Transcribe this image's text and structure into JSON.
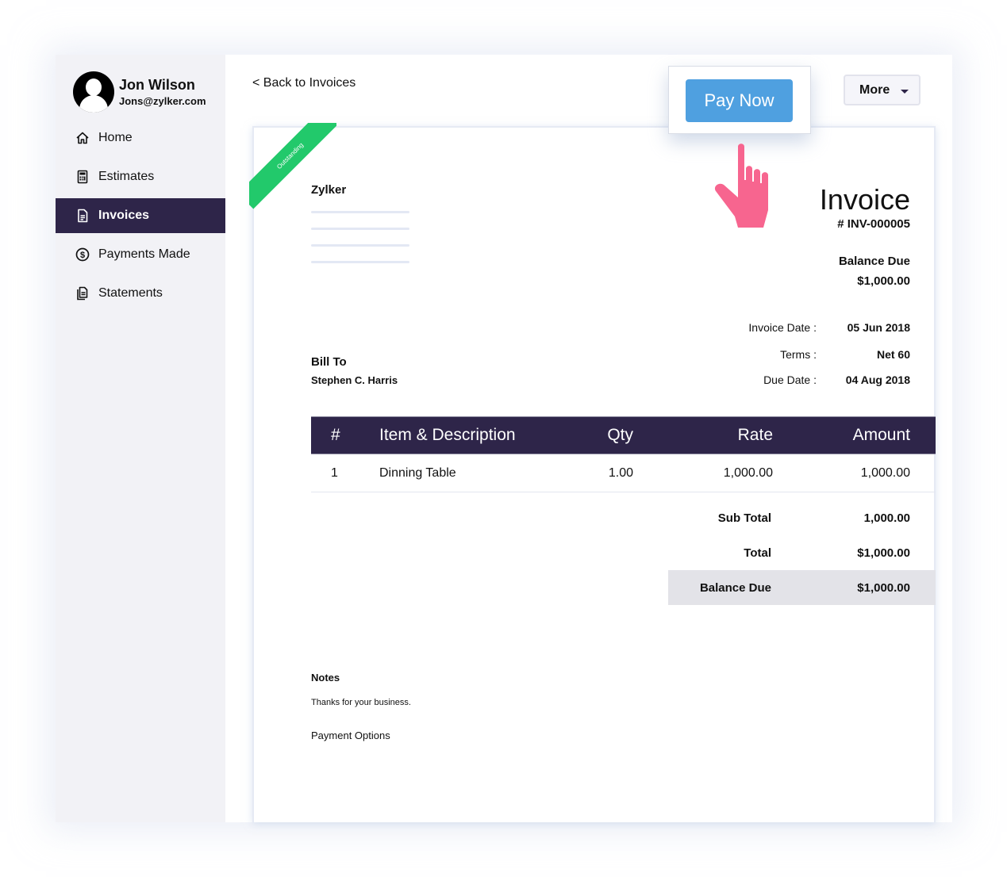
{
  "user": {
    "name": "Jon Wilson",
    "email": "Jons@zylker.com"
  },
  "sidebar": {
    "items": [
      {
        "label": "Home",
        "icon": "home-icon",
        "active": false
      },
      {
        "label": "Estimates",
        "icon": "calculator-icon",
        "active": false
      },
      {
        "label": "Invoices",
        "icon": "document-icon",
        "active": true
      },
      {
        "label": "Payments Made",
        "icon": "dollar-circle-icon",
        "active": false
      },
      {
        "label": "Statements",
        "icon": "statements-icon",
        "active": false
      }
    ]
  },
  "header": {
    "back_label": "< Back to Invoices",
    "pay_now_label": "Pay Now",
    "more_label": "More"
  },
  "colors": {
    "sidebar_active": "#2e2549",
    "pay_button": "#4fa0e0",
    "status_ribbon": "#22c96b",
    "pointer_hand": "#f7658f",
    "balance_highlight": "#e3e3e8"
  },
  "invoice": {
    "status": "Outstanding",
    "company": "Zylker",
    "title": "Invoice",
    "number": "# INV-000005",
    "balance_due_label": "Balance Due",
    "balance_due_value": "$1,000.00",
    "meta": [
      {
        "label": "Invoice Date :",
        "value": "05 Jun 2018"
      },
      {
        "label": "Terms :",
        "value": "Net 60"
      },
      {
        "label": "Due Date :",
        "value": "04 Aug 2018"
      }
    ],
    "bill_to_label": "Bill To",
    "bill_to_name": "Stephen C. Harris",
    "table": {
      "headers": [
        "#",
        "Item & Description",
        "Qty",
        "Rate",
        "Amount"
      ],
      "rows": [
        [
          "1",
          "Dinning Table",
          "1.00",
          "1,000.00",
          "1,000.00"
        ]
      ]
    },
    "totals": [
      {
        "label": "Sub Total",
        "value": "1,000.00"
      },
      {
        "label": "Total",
        "value": "$1,000.00"
      },
      {
        "label": "Balance Due",
        "value": "$1,000.00"
      }
    ],
    "notes_label": "Notes",
    "notes_text": "Thanks for your business.",
    "payment_options_label": "Payment Options"
  }
}
